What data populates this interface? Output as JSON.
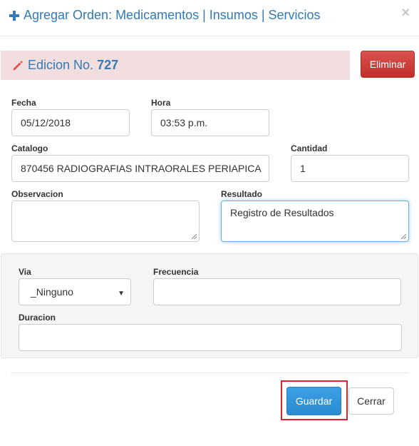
{
  "header": {
    "title": "Agregar Orden: Medicamentos | Insumos | Servicios",
    "close_label": "×"
  },
  "edition": {
    "prefix": "Edicion No.",
    "number": "727",
    "delete_label": "Eliminar"
  },
  "form": {
    "fecha_label": "Fecha",
    "fecha_value": "05/12/2018",
    "hora_label": "Hora",
    "hora_value": "03:53 p.m.",
    "catalogo_label": "Catalogo",
    "catalogo_value": "870456 RADIOGRAFIAS INTRAORALES PERIAPICA",
    "cantidad_label": "Cantidad",
    "cantidad_value": "1",
    "observacion_label": "Observacion",
    "observacion_value": "",
    "resultado_label": "Resultado",
    "resultado_value": "Registro de Resultados"
  },
  "panel": {
    "via_label": "Via",
    "via_selected": "_Ninguno",
    "frecuencia_label": "Frecuencia",
    "frecuencia_value": "",
    "duracion_label": "Duracion",
    "duracion_value": ""
  },
  "footer": {
    "save_label": "Guardar",
    "close_label": "Cerrar"
  },
  "colors": {
    "title": "#337ab7",
    "edition_bg": "#f2dede",
    "danger": "#d9534f",
    "primary": "#2b8bd0",
    "highlight": "#d9232e"
  },
  "icons": [
    "plus-icon",
    "close-icon",
    "pencil-icon",
    "chevron-down-icon"
  ]
}
